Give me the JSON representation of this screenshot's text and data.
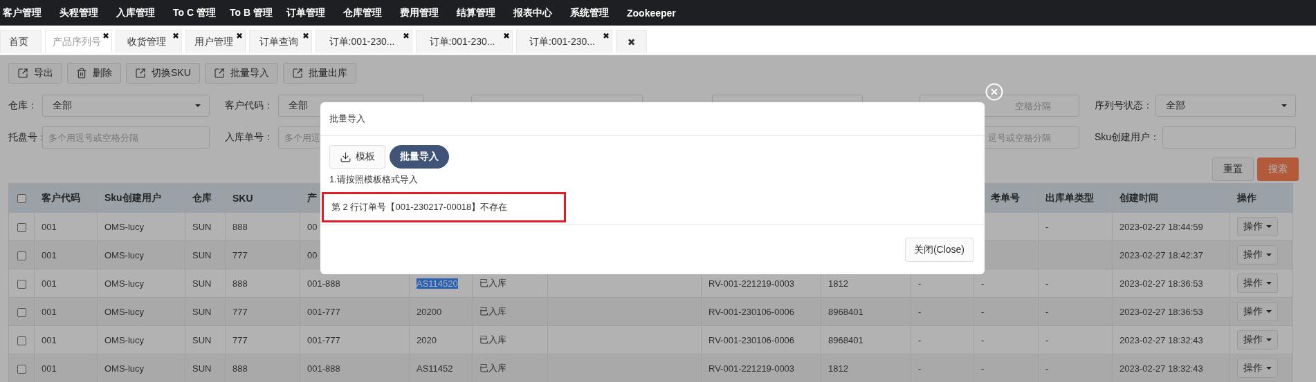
{
  "nav": {
    "items": [
      "客户管理",
      "头程管理",
      "入库管理",
      "To C 管理",
      "To B 管理",
      "订单管理",
      "仓库管理",
      "费用管理",
      "结算管理",
      "报表中心",
      "系统管理",
      "Zookeeper"
    ]
  },
  "tabs": [
    {
      "label": "首页",
      "selected": false
    },
    {
      "label": "产品序列号",
      "close": "✖",
      "selected": true
    },
    {
      "label": "收货管理",
      "close": "✖",
      "selected": false
    },
    {
      "label": "用户管理",
      "close": "✖",
      "selected": false
    },
    {
      "label": "订单查询",
      "close": "✖",
      "selected": false
    },
    {
      "label": "订单:001-230...",
      "close": "✖",
      "selected": false
    },
    {
      "label": "订单:001-230...",
      "close": "✖",
      "selected": false
    },
    {
      "label": "订单:001-230...",
      "close": "✖",
      "selected": false
    }
  ],
  "close_all_tabs": "✖",
  "toolbar": [
    {
      "label": "导出",
      "kind": "share"
    },
    {
      "label": "删除",
      "kind": "delete"
    },
    {
      "label": "切换SKU",
      "kind": "share"
    },
    {
      "label": "批量导入",
      "kind": "share"
    },
    {
      "label": "批量出库",
      "kind": "share"
    }
  ],
  "filters": [
    {
      "label": "仓库：",
      "kind": "select",
      "value": "全部"
    },
    {
      "label": "客户代码：",
      "kind": "select",
      "value": "全部"
    },
    {
      "kind": "input"
    },
    {
      "kind": "input"
    },
    {
      "kind": "input",
      "placeholder": "空格分隔"
    },
    {
      "label": "序列号状态：",
      "kind": "select",
      "value": "全部"
    },
    {
      "label": "托盘号：",
      "kind": "input",
      "placeholder": "多个用逗号或空格分隔"
    },
    {
      "label": "入库单号：",
      "kind": "input",
      "placeholder": "多个用逗"
    },
    {
      "kind": "input",
      "placeholder": "逗号或空格分隔"
    },
    {
      "label": "Sku创建用户：",
      "kind": "input"
    }
  ],
  "actions": [
    {
      "label": "重置",
      "kind": "default"
    },
    {
      "label": "搜索",
      "kind": "primary"
    }
  ],
  "table": {
    "header_checked": false,
    "columns_start": [
      "客户代码",
      "Sku创建用户",
      "仓库",
      "SKU",
      "产"
    ],
    "columns_end": [
      "考单号",
      "出库单类型",
      "创建时间",
      "操作"
    ],
    "rows": [
      {
        "checked": false,
        "start": [
          "001",
          "OMS-lucy",
          "SUN",
          "888",
          "00"
        ],
        "end": [
          "-",
          "2023-02-27 18:44:59",
          "操作"
        ]
      },
      {
        "checked": false,
        "start": [
          "001",
          "OMS-lucy",
          "SUN",
          "777",
          "00"
        ],
        "end": [
          "2023-02-27 18:42:37",
          "操作"
        ]
      },
      {
        "checked": false,
        "text_selected": true,
        "start": [
          "001",
          "OMS-lucy",
          "SUN",
          "888",
          "001-888",
          "AS114520",
          "已入库"
        ],
        "end": [
          "RV-001-221219-0003",
          "1812",
          "-",
          "-",
          "-",
          "2023-02-27 18:36:53",
          "操作"
        ]
      },
      {
        "checked": false,
        "text_selected": false,
        "start": [
          "001",
          "OMS-lucy",
          "SUN",
          "777",
          "001-777",
          "20200",
          "已入库"
        ],
        "end": [
          "RV-001-230106-0006",
          "8968401",
          "-",
          "-",
          "-",
          "2023-02-27 18:36:53",
          "操作"
        ]
      },
      {
        "checked": false,
        "text_selected": false,
        "start": [
          "001",
          "OMS-lucy",
          "SUN",
          "777",
          "001-777",
          "2020",
          "已入库"
        ],
        "end": [
          "RV-001-230106-0006",
          "8968401",
          "-",
          "-",
          "-",
          "2023-02-27 18:32:43",
          "操作"
        ]
      },
      {
        "checked": false,
        "text_selected": false,
        "start": [
          "001",
          "OMS-lucy",
          "SUN",
          "888",
          "001-888",
          "AS11452",
          "已入库"
        ],
        "end": [
          "RV-001-221219-0003",
          "1812",
          "-",
          "-",
          "-",
          "2023-02-27 18:32:43",
          "操作"
        ]
      }
    ]
  },
  "modal": {
    "title": "批量导入",
    "buttons": [
      {
        "label": "模板",
        "kind": "download"
      },
      {
        "label": "批量导入",
        "kind": "primary"
      }
    ],
    "instruction": "1.请按照模板格式导入",
    "error": "第 2 行订单号【001-230217-00018】不存在",
    "footer_button": "关闭(Close)"
  }
}
